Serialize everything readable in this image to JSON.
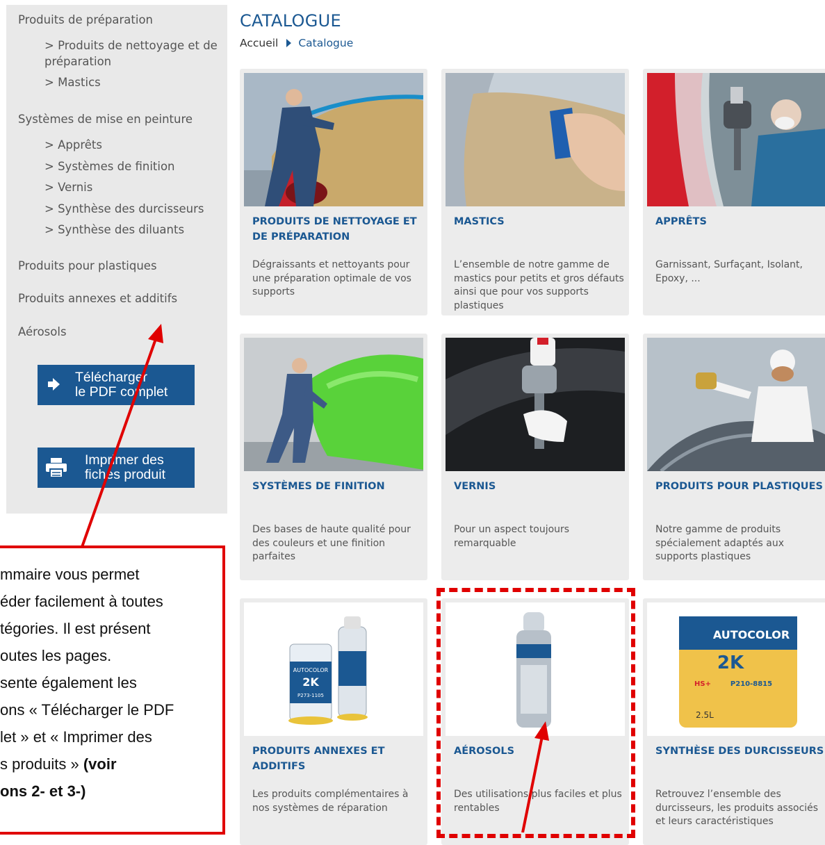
{
  "sidebar": {
    "categories": [
      {
        "label": "Produits de préparation",
        "children": [
          "Produits de nettoyage et de préparation",
          "Mastics"
        ]
      },
      {
        "label": "Systèmes de mise en peinture",
        "children": [
          "Apprêts",
          "Systèmes de finition",
          "Vernis",
          "Synthèse des durcisseurs",
          "Synthèse des diluants"
        ]
      },
      {
        "label": "Produits pour plastiques",
        "children": []
      },
      {
        "label": "Produits annexes et additifs",
        "children": []
      },
      {
        "label": "Aérosols",
        "children": []
      }
    ],
    "download_button": {
      "line1": "Télécharger",
      "line2": "le PDF complet",
      "icon": "arrow-right-icon"
    },
    "print_button": {
      "line1": "Imprimer des",
      "line2": "fiches produit",
      "icon": "printer-icon"
    }
  },
  "main": {
    "title": "CATALOGUE",
    "breadcrumb": {
      "home": "Accueil",
      "current": "Catalogue"
    },
    "cards": [
      {
        "title": "PRODUITS DE NETTOYAGE ET DE PRÉPARATION",
        "desc": "Dégraissants et nettoyants pour une préparation optimale de vos supports"
      },
      {
        "title": "MASTICS",
        "desc": "L’ensemble de notre gamme de mastics pour petits et gros défauts ainsi que pour vos supports plastiques"
      },
      {
        "title": "APPRÊTS",
        "desc": "Garnissant, Surfaçant, Isolant, Epoxy, ..."
      },
      {
        "title": "SYSTÈMES DE FINITION",
        "desc": "Des bases de haute qualité pour des couleurs et une finition parfaites"
      },
      {
        "title": "VERNIS",
        "desc": "Pour un aspect toujours remarquable"
      },
      {
        "title": "PRODUITS POUR PLASTIQUES",
        "desc": "Notre gamme de produits spécialement adaptés aux supports plastiques"
      },
      {
        "title": "PRODUITS ANNEXES ET ADDITIFS",
        "desc": "Les produits complémentaires à nos systèmes de réparation"
      },
      {
        "title": "AÉROSOLS",
        "desc": "Des utilisations plus faciles et plus rentables"
      },
      {
        "title": "SYNTHÈSE DES DURCISSEURS",
        "desc": "Retrouvez l’ensemble des durcisseurs, les produits associés et leurs caractéristiques"
      }
    ],
    "product_labels": {
      "brand": "AUTOCOLOR",
      "code_2k": "2K",
      "code_small": "P273-1105",
      "code_can": "P210-8815",
      "hs": "HS+",
      "volume": "2.5L"
    }
  },
  "annotation": {
    "lines": [
      "mmaire vous permet",
      "éder facilement à toutes",
      "tégories. Il est présent",
      "outes les pages.",
      "sente également les",
      "ons « Télécharger le PDF",
      "let » et « Imprimer des",
      "s produits » "
    ],
    "bold_tail": "(voir",
    "bold_last": "ons 2- et 3-)"
  },
  "colors": {
    "accent": "#1b5892",
    "annotation": "#e00000",
    "sidebar_bg": "#e9e9e9",
    "card_bg": "#ececec"
  }
}
